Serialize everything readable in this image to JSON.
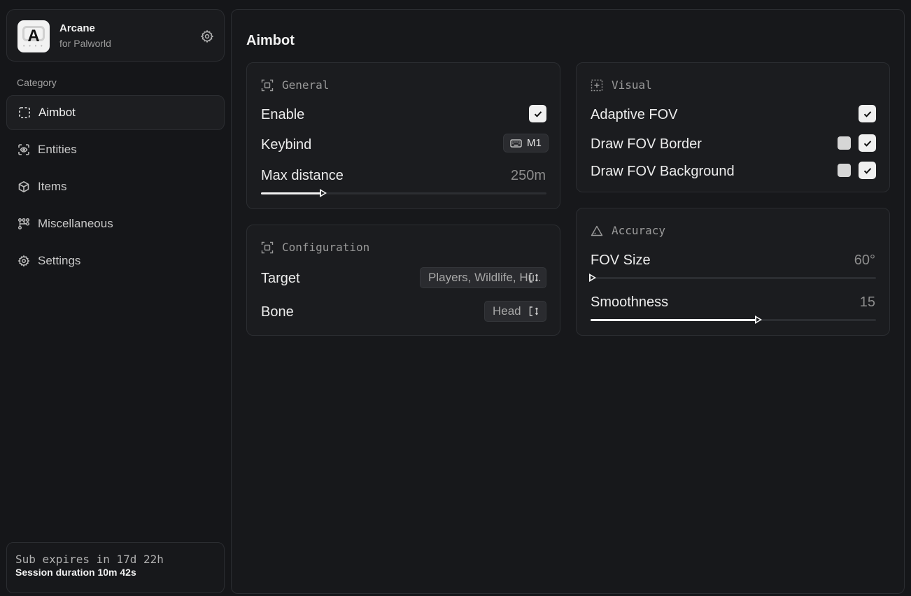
{
  "brand": {
    "title": "Arcane",
    "subtitle": "for Palworld",
    "logo_letter": "A"
  },
  "sidebar": {
    "category_label": "Category",
    "items": [
      {
        "label": "Aimbot",
        "icon": "dashed-square-icon",
        "active": true
      },
      {
        "label": "Entities",
        "icon": "scan-eye-icon"
      },
      {
        "label": "Items",
        "icon": "box-icon"
      },
      {
        "label": "Miscellaneous",
        "icon": "nodes-icon"
      },
      {
        "label": "Settings",
        "icon": "gear-icon"
      }
    ]
  },
  "footer": {
    "sub_expires": "Sub expires in 17d 22h",
    "session": "Session duration 10m 42s"
  },
  "page": {
    "title": "Aimbot"
  },
  "general": {
    "title": "General",
    "enable_label": "Enable",
    "enable_checked": true,
    "keybind_label": "Keybind",
    "keybind_value": "M1",
    "max_distance_label": "Max distance",
    "max_distance_value": "250m",
    "max_distance_fraction": 0.21
  },
  "configuration": {
    "title": "Configuration",
    "target_label": "Target",
    "target_value": "Players, Wildlife, Hu..",
    "bone_label": "Bone",
    "bone_value": "Head"
  },
  "visual": {
    "title": "Visual",
    "adaptive_fov_label": "Adaptive FOV",
    "adaptive_fov_checked": true,
    "draw_fov_border_label": "Draw FOV Border",
    "draw_fov_border_checked": true,
    "draw_fov_background_label": "Draw FOV Background",
    "draw_fov_background_checked": true
  },
  "accuracy": {
    "title": "Accuracy",
    "fov_size_label": "FOV Size",
    "fov_size_value": "60°",
    "fov_size_fraction": 0.0,
    "smoothness_label": "Smoothness",
    "smoothness_value": "15",
    "smoothness_fraction": 0.58
  },
  "colors": {
    "background": "#151619",
    "card": "#1b1c1f",
    "border": "#2b2d31",
    "accent": "#f2f2f2"
  }
}
